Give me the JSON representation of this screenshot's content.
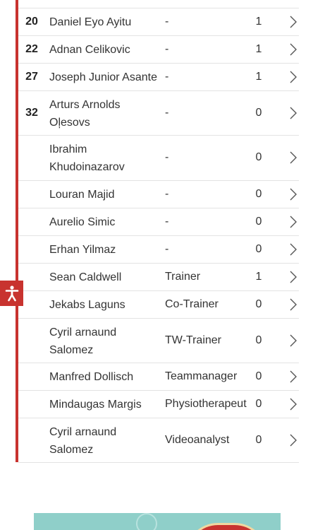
{
  "rows": [
    {
      "number": "20",
      "name_lines": [
        "Daniel Eyo Ayitu"
      ],
      "role": "-",
      "count": "1"
    },
    {
      "number": "22",
      "name_lines": [
        "Adnan Celikovic"
      ],
      "role": "-",
      "count": "1"
    },
    {
      "number": "27",
      "name_lines": [
        "Joseph Junior Asante"
      ],
      "role": "-",
      "count": "1"
    },
    {
      "number": "32",
      "name_lines": [
        "Arturs Arnolds",
        "Oļesovs"
      ],
      "role": "-",
      "count": "0"
    },
    {
      "number": "",
      "name_lines": [
        "Ibrahim",
        "Khudoinazarov"
      ],
      "role": "-",
      "count": "0"
    },
    {
      "number": "",
      "name_lines": [
        "Louran Majid"
      ],
      "role": "-",
      "count": "0"
    },
    {
      "number": "",
      "name_lines": [
        "Aurelio Simic"
      ],
      "role": "-",
      "count": "0"
    },
    {
      "number": "",
      "name_lines": [
        "Erhan Yilmaz"
      ],
      "role": "-",
      "count": "0"
    },
    {
      "number": "",
      "name_lines": [
        "Sean Caldwell"
      ],
      "role": "Trainer",
      "count": "1"
    },
    {
      "number": "",
      "name_lines": [
        "Jekabs Laguns"
      ],
      "role": "Co-Trainer",
      "count": "0"
    },
    {
      "number": "",
      "name_lines": [
        "Cyril arnaund",
        "Salomez"
      ],
      "role": "TW-Trainer",
      "count": "0"
    },
    {
      "number": "",
      "name_lines": [
        "Manfred Dollisch"
      ],
      "role": "Teammanager",
      "count": "0"
    },
    {
      "number": "",
      "name_lines": [
        "Mindaugas Margis"
      ],
      "role": "Physiotherapeut",
      "count": "0"
    },
    {
      "number": "",
      "name_lines": [
        "Cyril arnaund",
        "Salomez"
      ],
      "role": "Videoanalyst",
      "count": "0"
    }
  ],
  "icons": {
    "row_link": "chevron-right-icon",
    "accessibility": "accessibility-icon"
  },
  "colors": {
    "accent": "#c8332f",
    "banner": "#8fcfc9"
  }
}
